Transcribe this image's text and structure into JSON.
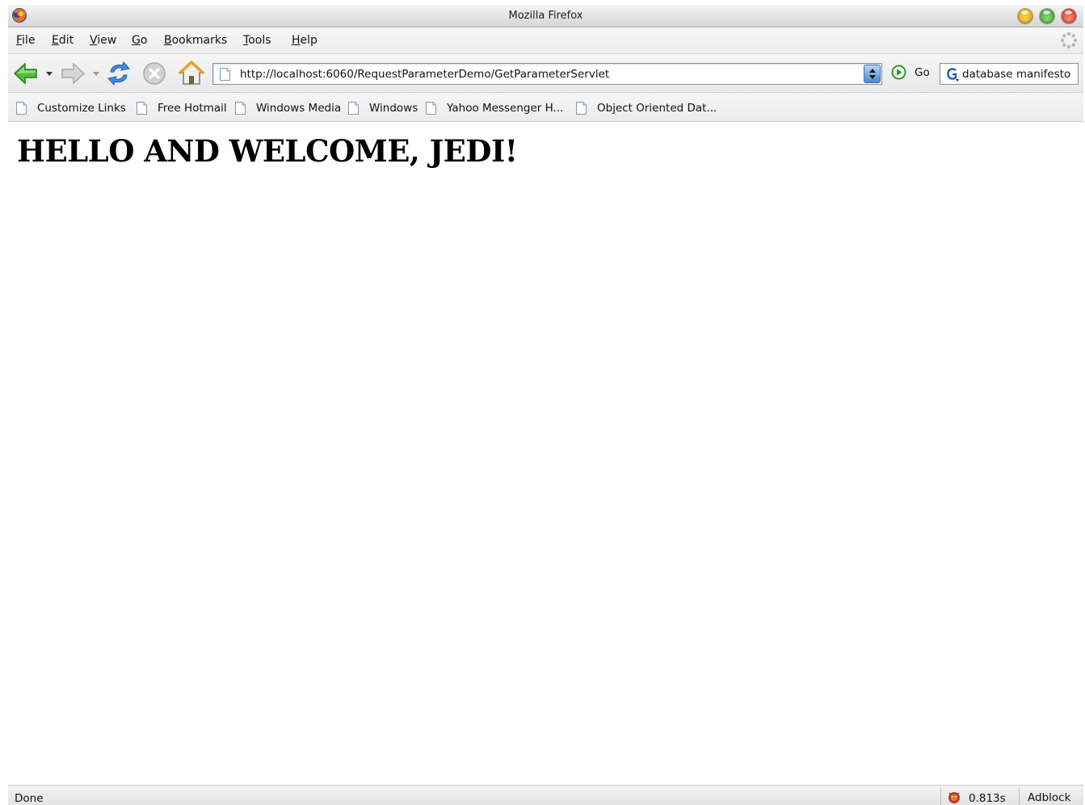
{
  "window": {
    "title": "Mozilla Firefox"
  },
  "menubar": {
    "items": [
      {
        "underline": "F",
        "rest": "ile"
      },
      {
        "underline": "E",
        "rest": "dit"
      },
      {
        "underline": "V",
        "rest": "iew"
      },
      {
        "underline": "G",
        "rest": "o"
      },
      {
        "underline": "B",
        "rest": "ookmarks"
      },
      {
        "underline": "T",
        "rest": "ools"
      },
      {
        "underline": "H",
        "rest": "elp"
      }
    ]
  },
  "navbar": {
    "url": "http://localhost:6060/RequestParameterDemo/GetParameterServlet",
    "go_label": "Go",
    "search_value": "database manifesto",
    "icons": [
      "back-arrow-icon",
      "forward-arrow-icon",
      "reload-icon",
      "stop-icon",
      "home-icon",
      "go-icon",
      "google-icon"
    ]
  },
  "bookmarks": {
    "items": [
      {
        "label": "Customize Links"
      },
      {
        "label": "Free Hotmail"
      },
      {
        "label": "Windows Media"
      },
      {
        "label": "Windows"
      },
      {
        "label": "Yahoo Messenger H..."
      },
      {
        "label": "Object Oriented Dat..."
      }
    ]
  },
  "content": {
    "heading": "HELLO AND WELCOME, JEDI!"
  },
  "statusbar": {
    "status": "Done",
    "timing": "0.813s",
    "adblock": "Adblock"
  },
  "colors": {
    "titlebar": "#d6d6d6",
    "min_button": "#f0b020",
    "max_button": "#3fae30",
    "close_button": "#e0392a",
    "nav_arrow_green": "#3cb043",
    "reload_blue": "#2f78d8"
  }
}
